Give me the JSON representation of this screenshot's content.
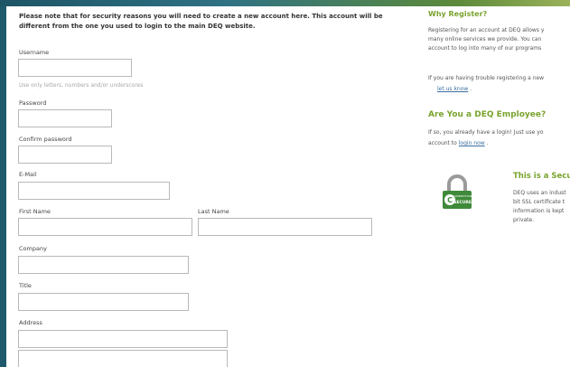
{
  "notice": {
    "line1": "Please note that for security reasons you will need to create a new account here. This account will be",
    "line2": "different from the one you used to login to the main DEQ website."
  },
  "form": {
    "username_label": "Username",
    "username_hint": "Use only letters, numbers and/or underscores",
    "password_label": "Password",
    "confirm_password_label": "Confirm password",
    "email_label": "E-Mail",
    "first_name_label": "First Name",
    "last_name_label": "Last Name",
    "company_label": "Company",
    "title_label": "Title",
    "address_label": "Address"
  },
  "sidebar": {
    "why_heading": "Why Register?",
    "why_line1": "Registering for an account at DEQ allows y",
    "why_line2": "many online services we provide. You can",
    "why_line3": "account to log into many of our programs",
    "trouble_line1": "If you are having trouble registering a new",
    "trouble_link": "let us know",
    "trouble_suffix": ".",
    "employee_heading": "Are You a DEQ Employee?",
    "employee_line1": "If so, you already have a login! Just use yo",
    "employee_prefix": "account to",
    "employee_link": "login now",
    "employee_suffix": ".",
    "secure_heading": "This is a Secu",
    "secure_line1": "DEQ uses an indust",
    "secure_line2": "bit SSL certificate t",
    "secure_line3": "information is kept",
    "secure_line4": "private.",
    "badge_top": "CONNECTION",
    "badge_bottom": "SECURE"
  },
  "colors": {
    "frame": "#1e5a6b",
    "heading_green": "#7aa32e",
    "link_blue": "#3b6fa0",
    "badge_green": "#3f8a3a"
  }
}
